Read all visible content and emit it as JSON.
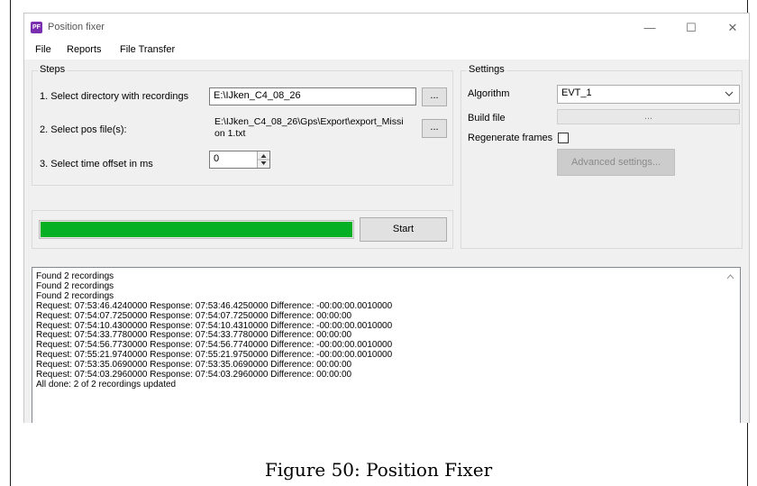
{
  "window": {
    "title": "Position fixer",
    "app_icon_text": "PF",
    "minimize": "—",
    "maximize": "☐",
    "close": "✕"
  },
  "menu": [
    "File",
    "Reports",
    "File Transfer"
  ],
  "steps": {
    "group_label": "Steps",
    "step1_label": "1. Select directory with recordings",
    "step1_value": "E:\\IJken_C4_08_26",
    "step2_label": "2. Select pos file(s):",
    "step2_value_line1": "E:\\IJken_C4_08_26\\Gps\\Export\\export_Missi",
    "step2_value_line2": "on 1.txt",
    "step3_label": "3. Select time offset in ms",
    "step3_value": "0",
    "browse_label": "..."
  },
  "progress": {
    "percent": 100,
    "color": "#06b025"
  },
  "start_button": "Start",
  "settings": {
    "group_label": "Settings",
    "algorithm_label": "Algorithm",
    "algorithm_value": "EVT_1",
    "build_file_label": "Build file",
    "build_file_button": "...",
    "regenerate_label": "Regenerate frames",
    "regenerate_checked": false,
    "advanced_button": "Advanced settings..."
  },
  "log": [
    "Found 2 recordings",
    "Found 2 recordings",
    "Found 2 recordings",
    "Request: 07:53:46.4240000 Response: 07:53:46.4250000 Difference: -00:00:00.0010000",
    "Request: 07:54:07.7250000 Response: 07:54:07.7250000 Difference: 00:00:00",
    "Request: 07:54:10.4300000 Response: 07:54:10.4310000 Difference: -00:00:00.0010000",
    "Request: 07:54:33.7780000 Response: 07:54:33.7780000 Difference: 00:00:00",
    "Request: 07:54:56.7730000 Response: 07:54:56.7740000 Difference: -00:00:00.0010000",
    "Request: 07:55:21.9740000 Response: 07:55:21.9750000 Difference: -00:00:00.0010000",
    "Request: 07:53:35.0690000 Response: 07:53:35.0690000 Difference: 00:00:00",
    "Request: 07:54:03.2960000 Response: 07:54:03.2960000 Difference: 00:00:00",
    "All done: 2 of 2 recordings updated"
  ],
  "caption": "Figure 50: Position Fixer"
}
